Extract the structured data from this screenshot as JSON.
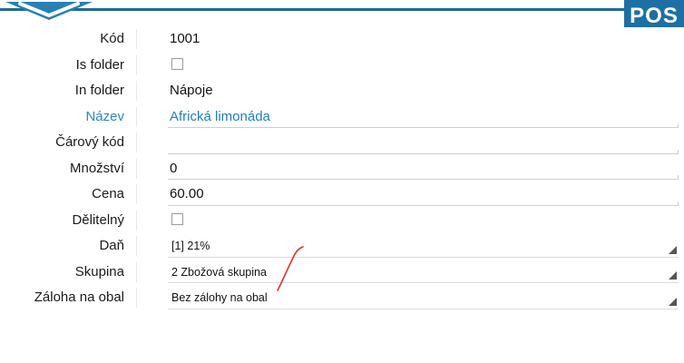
{
  "header": {
    "logo_text": "POS"
  },
  "form": {
    "rows": [
      {
        "label": "Kód",
        "value": "1001"
      },
      {
        "label": "Is folder",
        "checked": false
      },
      {
        "label": "In folder",
        "value": "Nápoje"
      },
      {
        "label": "Název",
        "value": "Africká limonáda"
      },
      {
        "label": "Čárový kód",
        "value": ""
      },
      {
        "label": "Množství",
        "value": "0"
      },
      {
        "label": "Cena",
        "value": "60.00"
      },
      {
        "label": "Dělitelný",
        "checked": false
      },
      {
        "label": "Daň",
        "value": "[1] 21%"
      },
      {
        "label": "Skupina",
        "value": "2 Zbožová skupina"
      },
      {
        "label": "Záloha na obal",
        "value": "Bez zálohy na obal"
      }
    ]
  },
  "colors": {
    "accent": "#2b86c5",
    "header_bar": "#1f6b97",
    "logo_bg": "#1d6fa5",
    "annotation": "#e0302a"
  }
}
